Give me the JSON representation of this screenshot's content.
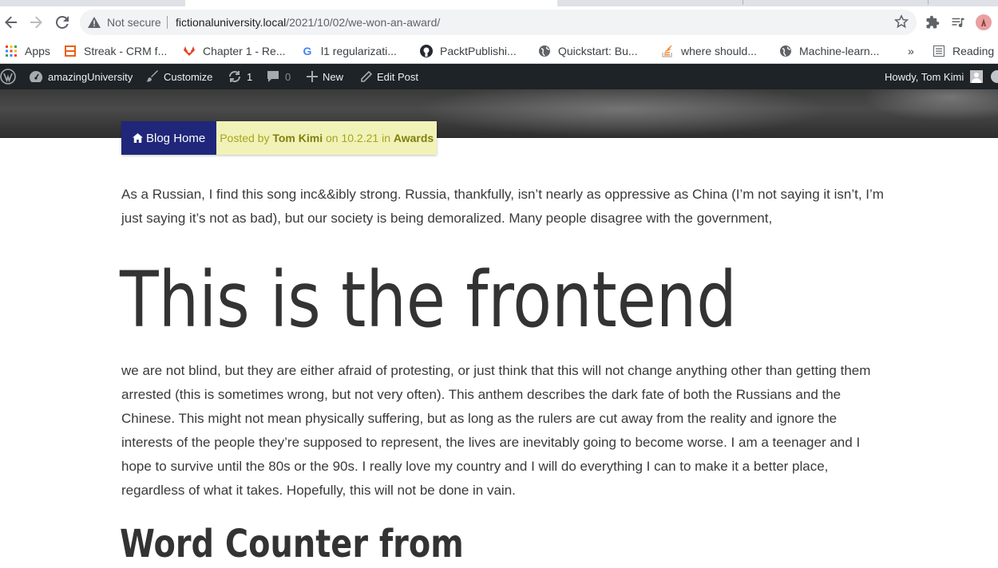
{
  "browser": {
    "security_label": "Not secure",
    "url_host": "fictionaluniversity.local",
    "url_path": "/2021/10/02/we-won-an-award/"
  },
  "bookmarks": {
    "items": [
      {
        "label": "Apps"
      },
      {
        "label": "Streak - CRM f..."
      },
      {
        "label": "Chapter 1 - Re..."
      },
      {
        "label": "l1 regularizati..."
      },
      {
        "label": "PacktPublishi..."
      },
      {
        "label": "Quickstart: Bu..."
      },
      {
        "label": "where should..."
      },
      {
        "label": "Machine-learn..."
      }
    ],
    "overflow": "»",
    "reading_list": "Reading"
  },
  "adminbar": {
    "site_name": "amazingUniversity",
    "customize": "Customize",
    "updates_count": "1",
    "comments_count": "0",
    "new": "New",
    "edit_post": "Edit Post",
    "howdy": "Howdy, Tom Kimi"
  },
  "meta": {
    "blog_home": "Blog Home",
    "posted_by": "Posted by",
    "author": "Tom Kimi",
    "on": "on",
    "date": "10.2.21",
    "in": "in",
    "category": "Awards"
  },
  "content": {
    "para1": "As a Russian, I find this song inc&&ibly strong. Russia, thankfully, isn’t nearly as oppressive as China (I’m not saying it isn’t, I’m just saying it’s not as bad), but our society is being demoralized. Many people disagree with the government,",
    "heading": "This is the frontend",
    "para2": "we are not blind, but they are either afraid of protesting, or just think that this will not change anything other than getting them arrested (this is sometimes wrong, but not very often). This anthem describes the dark fate of both the Russians and the Chinese. This might not mean physically suffering, but as long as the rulers are cut away from the reality and ignore the interests of the people they’re supposed to represent, the lives are inevitably going to become worse. I am a teenager and I hope to survive until the 80s or the 90s. I really love my country and I will do everything I can to make it a better place, regardless of what it takes. Hopefully, this will not be done in vain.",
    "subheading": "Word Counter from"
  },
  "colors": {
    "admin_bar": "#1d2327",
    "blog_home_bg": "#20277a",
    "meta_bg": "#f1f2b8",
    "meta_text": "#a5a51e"
  }
}
